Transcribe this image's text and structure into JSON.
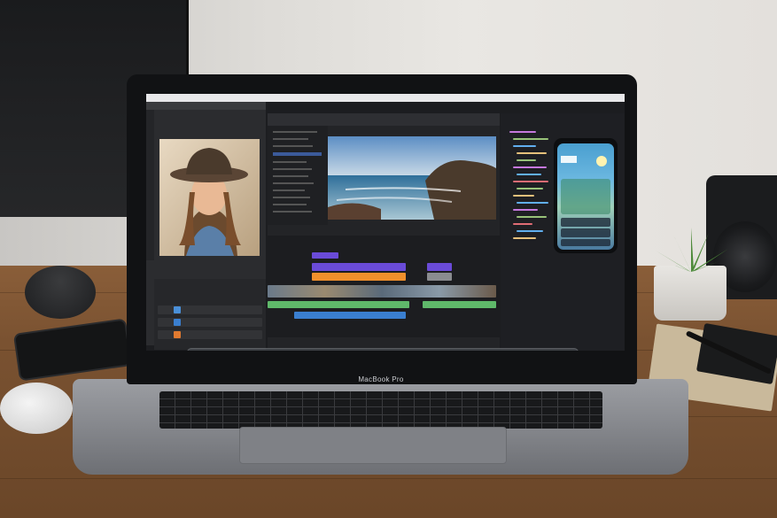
{
  "laptop": {
    "model_label": "MacBook Pro"
  },
  "props": {
    "smartphone": "phone-icon",
    "mouse": "mouse-icon",
    "camera": "camera-icon",
    "plant": "plant-icon",
    "notebook": "notebook-icon",
    "pen": "pen-icon"
  },
  "screen": {
    "apps": [
      "photo-editor",
      "video-editor",
      "code-editor"
    ],
    "dock_icons": [
      "finder-icon",
      "photos-icon",
      "safari-icon",
      "files-icon",
      "preview-icon",
      "notes-icon",
      "chrome-icon",
      "pages-icon",
      "calendar-icon",
      "music-icon",
      "scissors-icon",
      "premiere-icon",
      "launchpad-icon",
      "spotify-icon",
      "keynote-icon",
      "safari-icon",
      "itunes-icon",
      "spotify-icon",
      "mail-icon",
      "folder-icon",
      "trash-icon"
    ]
  },
  "colors": {
    "timeline_purple": "#6a4bd8",
    "timeline_orange": "#f0902c",
    "timeline_green": "#5fb86a",
    "timeline_blue": "#3a7fd0",
    "desk_wood": "#7a5231"
  }
}
